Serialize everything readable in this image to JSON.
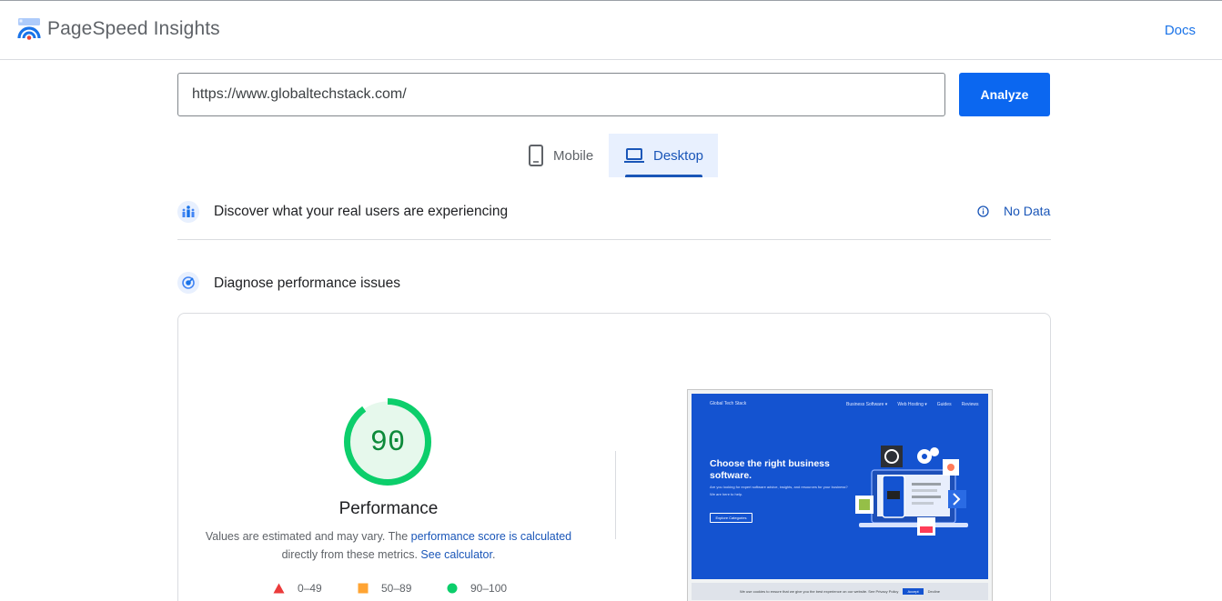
{
  "header": {
    "title": "PageSpeed Insights",
    "docs_label": "Docs"
  },
  "url_bar": {
    "value": "https://www.globaltechstack.com/",
    "analyze_label": "Analyze"
  },
  "device_tabs": {
    "mobile_label": "Mobile",
    "desktop_label": "Desktop",
    "selected": "Desktop"
  },
  "real_users": {
    "title": "Discover what your real users are experiencing",
    "status": "No Data"
  },
  "diagnose": {
    "title": "Diagnose performance issues"
  },
  "performance": {
    "score": "90",
    "score_value": 90,
    "title": "Performance",
    "desc_prefix": "Values are estimated and may vary. The ",
    "desc_link1": "performance score is calculated",
    "desc_middle": " directly from these metrics. ",
    "desc_link2": "See calculator",
    "desc_suffix": ".",
    "legend": [
      {
        "label": "0–49",
        "shape": "triangle",
        "color": "#eb3b3b"
      },
      {
        "label": "50–89",
        "shape": "square",
        "color": "#ffa433"
      },
      {
        "label": "90–100",
        "shape": "circle",
        "color": "#0cce6b"
      }
    ]
  },
  "screenshot": {
    "brand": "Global Tech Stack",
    "nav": [
      "Business Software ▾",
      "Web Hosting ▾",
      "Guides",
      "Reviews"
    ],
    "headline": "Choose the right business software.",
    "body": "Are you looking for expert software advice, insights, and resources for your business?",
    "body2": "We are here to help.",
    "button": "Explore Categories",
    "cookie_text": "We use cookies to ensure that we give you the best experience on our website. See Privacy Policy",
    "cookie_accept": "Accept",
    "cookie_decline": "Decline"
  },
  "colors": {
    "accent": "#0b67f0",
    "pass": "#0cce6b",
    "link": "#1a56b8"
  }
}
